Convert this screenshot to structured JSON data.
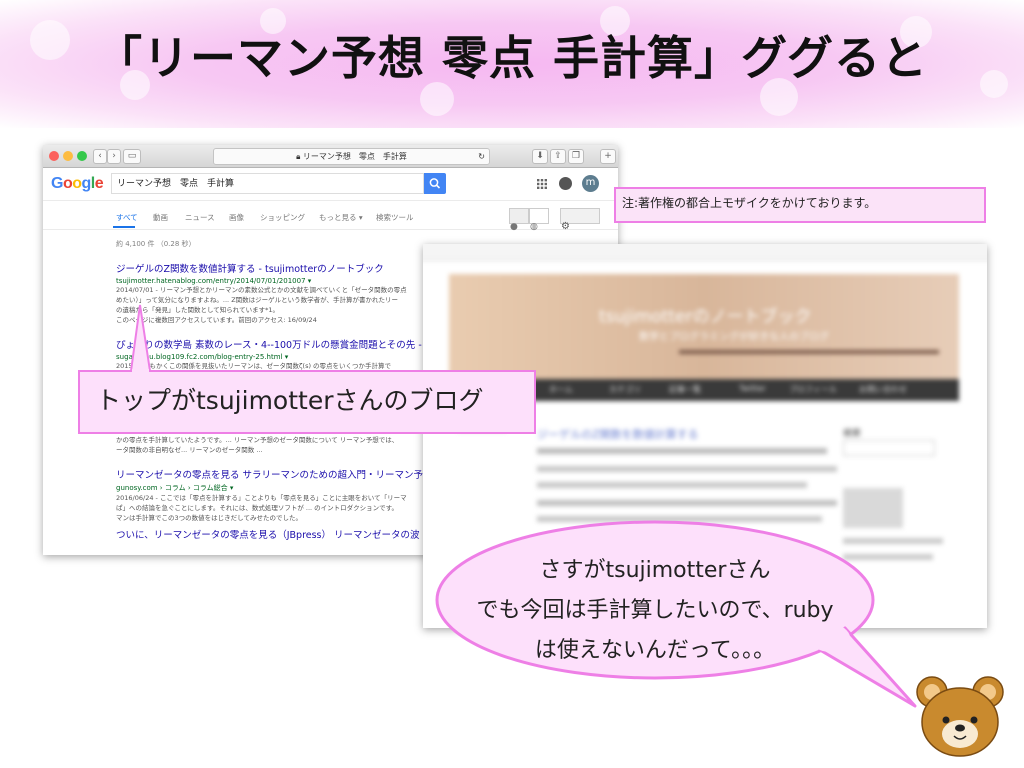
{
  "slide": {
    "title": "「リーマン予想 零点 手計算」ググると"
  },
  "browser": {
    "address": "リーマン予想　零点　手計算",
    "logo": {
      "text": "Google",
      "letter_colors": [
        "#4285f4",
        "#ea4335",
        "#fbbc05",
        "#4285f4",
        "#34a853",
        "#ea4335"
      ]
    },
    "search_query": "リーマン予想　零点　手計算",
    "account_initial": "m",
    "tabs": [
      "すべて",
      "動画",
      "ニュース",
      "画像",
      "ショッピング",
      "もっと見る ▾",
      "検索ツール"
    ],
    "result_stats": "約 4,100 件 （0.28 秒）",
    "results": [
      {
        "title": "ジーゲルのZ関数を数値計算する - tsujimotterのノートブック",
        "url": "tsujimotter.hatenablog.com/entry/2014/07/01/201007 ▾",
        "snippet": [
          "2014/07/01 - リーマン予想とかリーマンの素数公式とかの文献を調べていくと「ゼータ関数の零点",
          "めたい）」って気分になりますよね。... Z関数はジーゲルという数学者が、手計算が書かれたリー",
          "の遺稿から「発見」した関数として知られています*1。",
          "このページに複数回アクセスしています。前回のアクセス: 16/09/24"
        ]
      },
      {
        "title": "ぴょこりの数学島 素数のレース・4--100万ドルの懸賞金問題とその先 - FC",
        "url": "sugakushu.blog109.fc2.com/blog-entry-25.html ▾",
        "snippet": [
          "2015/... ともかくこの関係を見抜いたリーマンは、ゼータ関数ζ(s) の零点をいくつか手計算で"
        ]
      },
      {
        "title": "",
        "url": "",
        "snippet": [
          "かの零点を手計算していたようです。... リーマン予想のゼータ関数について リーマン予想では、",
          "ータ関数の非自明なゼ... リーマンのゼータ関数 ..."
        ]
      },
      {
        "title": "リーマンゼータの零点を見る サラリーマンのための超入門・リーマン予",
        "url": "gunosy.com › コラム › コラム総合 ▾",
        "snippet": [
          "2016/06/24 - ここでは「零点を計算する」ことよりも「零点を見る」ことに主眼をおいて「リーマ",
          "ぱ」への結論を急ぐことにします。それには、数式処理ソフトが ... のイントロダクションです。",
          "マンは手計算でこの3つの数値をはじきだしてみせたのでした。"
        ]
      },
      {
        "title": "ついに、リーマンゼータの零点を見る（JBpress） リーマンゼータの波",
        "url": "",
        "snippet": []
      }
    ]
  },
  "note": "注:著作権の都合上モザイクをかけております。",
  "blurred_page": {
    "header_title": "tsujimotterのノートブック",
    "header_subtitle": "数学とプログラミングが好きな人のブログ",
    "nav_items": [
      "ホーム",
      "カテゴリ",
      "記事一覧",
      "Twitter",
      "プロフィール",
      "お問い合わせ"
    ],
    "post_title": "ジーゲルのZ関数を数値計算する",
    "sidebar_heading": "検索"
  },
  "callout": "トップがtsujimotterさんのブログ",
  "speech": {
    "lines": [
      "さすがtsujimotterさん",
      "でも今回は手計算したいので、ruby",
      "は使えないんだって。。。"
    ]
  },
  "colors": {
    "accent_pink": "#ee7fe6",
    "pink_fill": "#fde0fb",
    "link_blue": "#1a0dab",
    "url_green": "#006621",
    "bear_brown": "#c98a2e"
  }
}
